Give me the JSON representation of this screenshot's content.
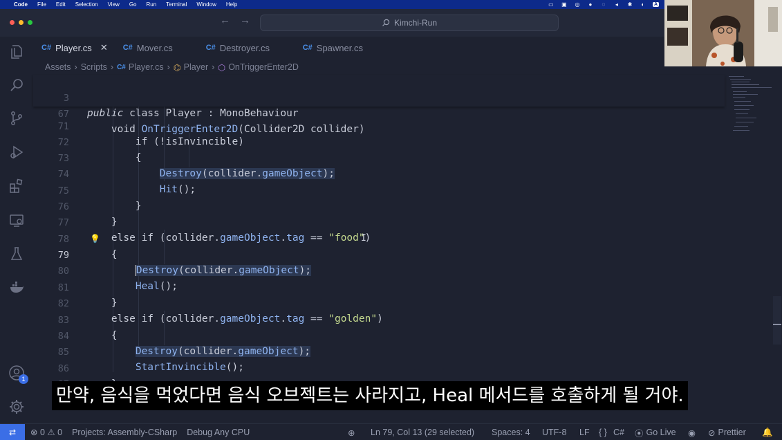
{
  "menubar": {
    "items": [
      "Code",
      "File",
      "Edit",
      "Selection",
      "View",
      "Go",
      "Run",
      "Terminal",
      "Window",
      "Help"
    ],
    "tray_badge": "A"
  },
  "titlebar": {
    "search_text": "Kimchi-Run"
  },
  "tabs": [
    {
      "label": "Player.cs",
      "active": true
    },
    {
      "label": "Mover.cs",
      "active": false
    },
    {
      "label": "Destroyer.cs",
      "active": false
    },
    {
      "label": "Spawner.cs",
      "active": false
    }
  ],
  "breadcrumb": [
    "Assets",
    "Scripts",
    "Player.cs",
    "Player",
    "OnTriggerEnter2D"
  ],
  "activity_badge": "1",
  "editor": {
    "sticky": [
      {
        "num": "3",
        "text": "public class Player : MonoBehaviour"
      },
      {
        "num": "67",
        "text": "    void OnTriggerEnter2D(Collider2D collider)"
      }
    ],
    "lines": [
      {
        "num": "71",
        "text": "        if (!isInvincible)"
      },
      {
        "num": "72",
        "text": "        {"
      },
      {
        "num": "73",
        "text": "            Destroy(collider.gameObject);"
      },
      {
        "num": "74",
        "text": "            Hit();"
      },
      {
        "num": "75",
        "text": "        }"
      },
      {
        "num": "76",
        "text": "    }"
      },
      {
        "num": "77",
        "text": "    else if (collider.gameObject.tag == \"food\")"
      },
      {
        "num": "78",
        "text": "    {"
      },
      {
        "num": "79",
        "text": "        Destroy(collider.gameObject);"
      },
      {
        "num": "80",
        "text": "        Heal();"
      },
      {
        "num": "81",
        "text": "    }"
      },
      {
        "num": "82",
        "text": "    else if (collider.gameObject.tag == \"golden\")"
      },
      {
        "num": "83",
        "text": "    {"
      },
      {
        "num": "84",
        "text": "        Destroy(collider.gameObject);"
      },
      {
        "num": "85",
        "text": "        StartInvincible();"
      },
      {
        "num": "86",
        "text": "    }"
      },
      {
        "num": "87",
        "text": "}"
      }
    ],
    "current_line": "79"
  },
  "subtitle": "만약, 음식을 먹었다면 음식 오브젝트는 사라지고, Heal 메서드를 호출하게 될 거야.",
  "statusbar": {
    "errors": "0",
    "warnings": "0",
    "project": "Projects: Assembly-CSharp",
    "config": "Debug Any CPU",
    "cursor": "Ln 79, Col 13 (29 selected)",
    "spaces": "Spaces: 4",
    "encoding": "UTF-8",
    "eol": "LF",
    "language": "C#",
    "golive": "Go Live",
    "prettier": "Prettier"
  },
  "colors": {
    "menubar": "#0d2a8a",
    "editor_bg": "#1e2230",
    "accent": "#3b6ee6",
    "function": "#8fb3ef",
    "string": "#c3d88e"
  }
}
